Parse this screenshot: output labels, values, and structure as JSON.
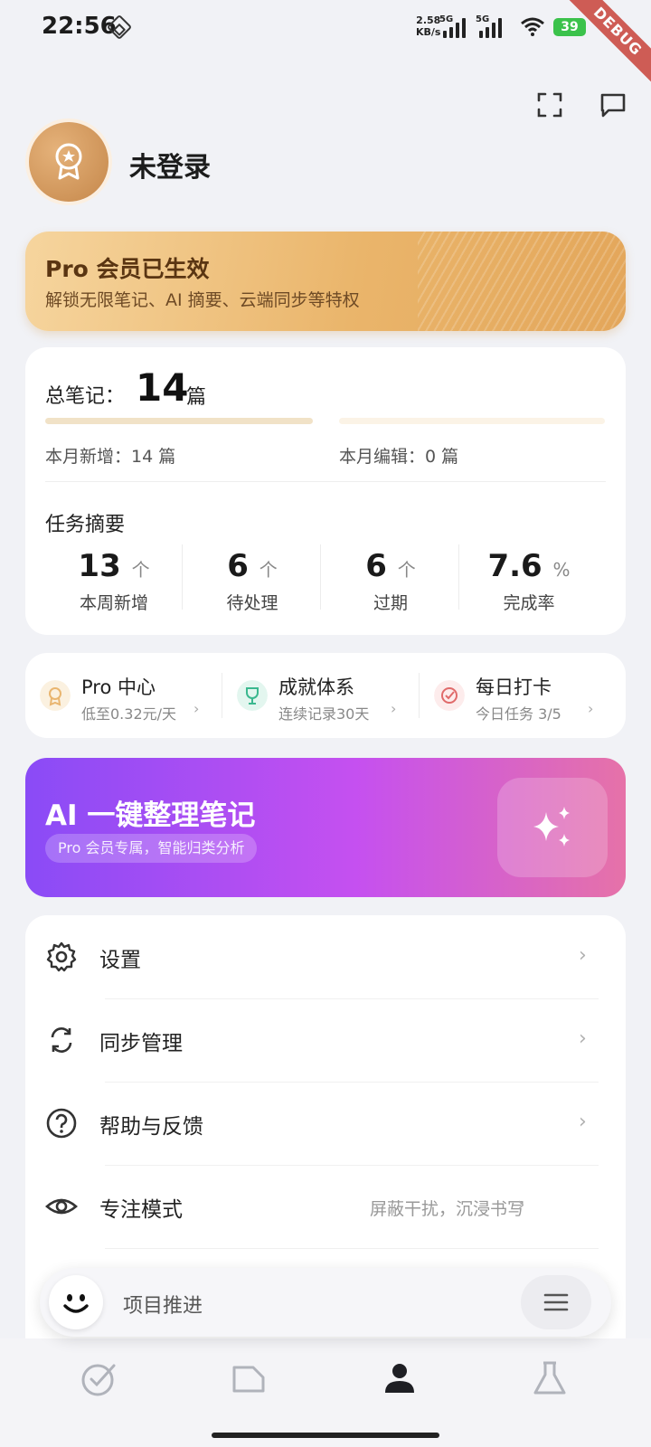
{
  "status_bar": {
    "time": "22:56",
    "net_speed_value": "2.58",
    "net_speed_unit": "KB/s",
    "sim1": "5G",
    "sim2": "5G",
    "battery": "39",
    "debug_label": "DEBUG"
  },
  "profile": {
    "username": "未登录",
    "icons": [
      "scan-icon",
      "message-icon"
    ]
  },
  "pro_banner": {
    "title": "Pro 会员已生效",
    "subtitle": "解锁无限笔记、AI 摘要、云端同步等特权"
  },
  "notes_stats": {
    "total_label": "总笔记：",
    "total_value": "14",
    "total_unit": "篇",
    "month_new": "本月新增：14 篇",
    "month_edited": "本月编辑：0 篇"
  },
  "task_summary": {
    "title": "任务摘要",
    "items": [
      {
        "value": "13",
        "unit": "个",
        "label": "本周新增"
      },
      {
        "value": "6",
        "unit": "个",
        "label": "待处理"
      },
      {
        "value": "6",
        "unit": "个",
        "label": "过期"
      },
      {
        "value": "7.6",
        "unit": "%",
        "label": "完成率"
      }
    ]
  },
  "quick_links": [
    {
      "title": "Pro 中心",
      "subtitle": "低至0.32元/天",
      "icon": "medal-icon",
      "color": "#e9b56f"
    },
    {
      "title": "成就体系",
      "subtitle": "连续记录30天",
      "icon": "trophy-icon",
      "color": "#3bb88f"
    },
    {
      "title": "每日打卡",
      "subtitle": "今日任务 3/5",
      "icon": "check-circle-icon",
      "color": "#e06a6a"
    }
  ],
  "ai_banner": {
    "title": "AI 一键整理笔记",
    "pill": "Pro 会员专属，智能归类分析",
    "icon": "sparkle-icon"
  },
  "menu": [
    {
      "label": "设置",
      "icon": "gear-icon",
      "description": ""
    },
    {
      "label": "同步管理",
      "icon": "sync-icon",
      "description": ""
    },
    {
      "label": "帮助与反馈",
      "icon": "help-icon",
      "description": ""
    },
    {
      "label": "专注模式",
      "icon": "eye-icon",
      "description": "屏蔽干扰，沉浸书写"
    }
  ],
  "floating_bar": {
    "text": "项目推进"
  },
  "bottom_nav": [
    {
      "name": "tasks",
      "icon": "check-circle-icon"
    },
    {
      "name": "notes",
      "icon": "folder-icon"
    },
    {
      "name": "profile",
      "icon": "person-icon",
      "active": true
    },
    {
      "name": "lab",
      "icon": "flask-icon"
    }
  ],
  "colors": {
    "accent_gold": "#e3a65a",
    "ai_purple": "#8a4bf6",
    "ai_pink": "#e672a8",
    "page_bg": "#f1f2f6"
  }
}
